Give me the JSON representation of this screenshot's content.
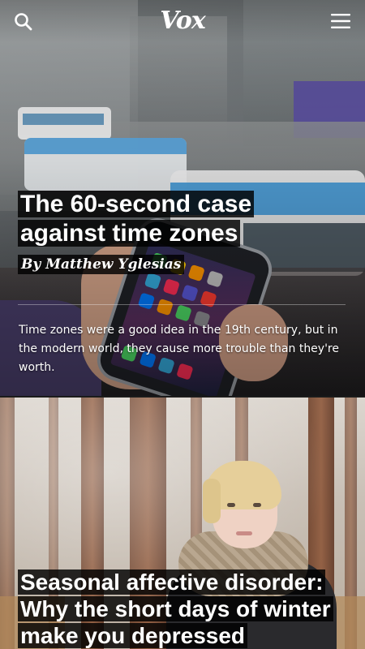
{
  "header": {
    "logo": "Vox",
    "search_icon": "search-icon",
    "menu_icon": "hamburger-menu-icon"
  },
  "stories": [
    {
      "title": "The 60-second case against time zones",
      "byline": "By Matthew Yglesias",
      "dek": "Time zones were a good idea in the 19th century, but in the modern world, they cause more trouble than they're worth."
    },
    {
      "title": "Seasonal affective disorder: Why the short days of winter make you depressed"
    }
  ],
  "colors": {
    "headline_background": "#000000",
    "headline_text": "#ffffff"
  }
}
